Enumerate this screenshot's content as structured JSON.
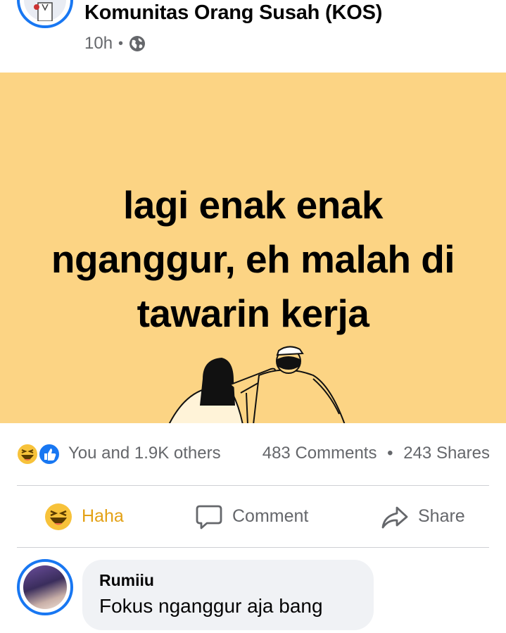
{
  "post": {
    "group_name": "Komunitas Orang Susah (KOS)",
    "time": "10h",
    "separator": "•",
    "privacy_icon": "globe-icon",
    "caption": "lagi enak enak\nnganggur, eh malah di\ntawarin kerja",
    "background_color": "#fcd484"
  },
  "reactions": {
    "icons": [
      "haha-reaction-icon",
      "like-reaction-icon"
    ],
    "summary": "You and 1.9K others",
    "comments": "483 Comments",
    "separator": "•",
    "shares": "243 Shares"
  },
  "actions": {
    "haha_label": "Haha",
    "comment_label": "Comment",
    "share_label": "Share",
    "active_color": "#e3a116"
  },
  "comment": {
    "author": "Rumiiu",
    "text": "Fokus nganggur aja bang"
  },
  "colors": {
    "accent": "#1877f2",
    "muted_text": "#65676b"
  }
}
